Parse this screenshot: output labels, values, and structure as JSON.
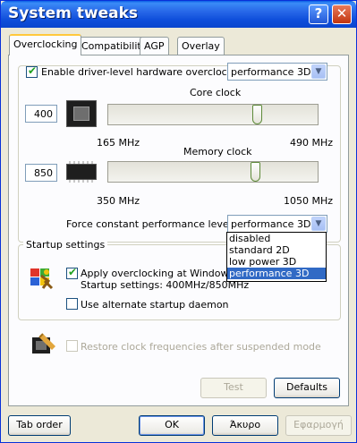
{
  "window": {
    "title": "System tweaks"
  },
  "title_buttons": {
    "help": "?",
    "close": "✕"
  },
  "tabs": [
    {
      "label": "Overclocking",
      "active": true
    },
    {
      "label": "Compatibility",
      "active": false
    },
    {
      "label": "AGP",
      "active": false
    },
    {
      "label": "Overlay",
      "active": false
    }
  ],
  "overclocking": {
    "enable_label": "Enable driver-level hardware overclocking",
    "enable_checked": true,
    "mode_value": "performance 3D",
    "core": {
      "label": "Core clock",
      "value": "400",
      "min": "165 MHz",
      "max": "490 MHz",
      "slider_value": 400,
      "slider_min": 165,
      "slider_max": 490
    },
    "memory": {
      "label": "Memory clock",
      "value": "850",
      "min": "350 MHz",
      "max": "1050 MHz",
      "slider_value": 850,
      "slider_min": 350,
      "slider_max": 1050
    },
    "force_label": "Force constant performance level",
    "force_value": "performance 3D",
    "force_options": [
      "disabled",
      "standard 2D",
      "low power 3D",
      "performance 3D"
    ],
    "force_selected_index": 3
  },
  "startup": {
    "group_title": "Startup settings",
    "apply_label": "Apply overclocking at Windows sta",
    "apply_checked": true,
    "settings_text": "Startup settings: 400MHz/850MHz",
    "alt_daemon_label": "Use alternate startup daemon",
    "alt_daemon_checked": false
  },
  "restore": {
    "label": "Restore clock frequencies after suspended mode",
    "checked": false
  },
  "panel_buttons": {
    "test": "Test",
    "defaults": "Defaults"
  },
  "footer_buttons": {
    "tab_order": "Tab order",
    "ok": "OK",
    "cancel": "Άκυρο",
    "apply": "Εφαρμογή"
  },
  "colors": {
    "title_bar": "#0A5FE6",
    "tab_highlight": "#FFC83C",
    "selection": "#316AC5",
    "check": "#21A121"
  }
}
